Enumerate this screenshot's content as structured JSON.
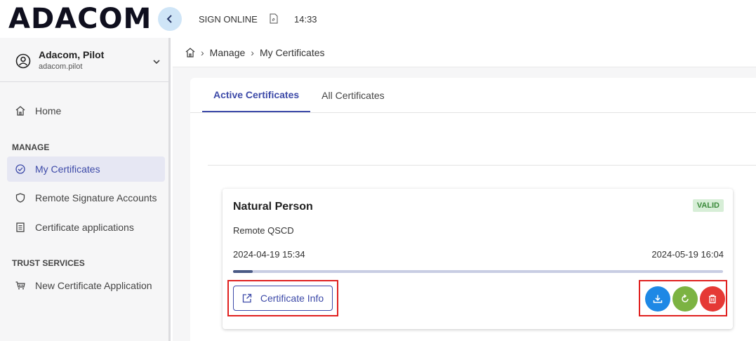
{
  "header": {
    "logo": "ADACOM",
    "app_label": "SIGN ONLINE",
    "time": "14:33",
    "icons": {
      "collapse": "chevron-left-icon",
      "pdf": "pdf-file-icon"
    }
  },
  "user": {
    "name": "Adacom, Pilot",
    "username": "adacom.pilot"
  },
  "sidebar": {
    "home": "Home",
    "manage_label": "MANAGE",
    "manage_items": [
      {
        "label": "My Certificates",
        "icon": "check-circle-icon",
        "active": true
      },
      {
        "label": "Remote Signature Accounts",
        "icon": "shield-icon",
        "active": false
      },
      {
        "label": "Certificate applications",
        "icon": "document-icon",
        "active": false
      }
    ],
    "trust_label": "TRUST SERVICES",
    "trust_items": [
      {
        "label": "New Certificate Application",
        "icon": "cart-icon",
        "active": false
      }
    ]
  },
  "breadcrumb": {
    "items": [
      "Manage",
      "My Certificates"
    ]
  },
  "tabs": [
    {
      "label": "Active Certificates",
      "active": true
    },
    {
      "label": "All Certificates",
      "active": false
    }
  ],
  "certificate": {
    "title": "Natural Person",
    "status": "VALID",
    "type": "Remote QSCD",
    "valid_from": "2024-04-19 15:34",
    "valid_to": "2024-05-19 16:04",
    "progress": 0.04,
    "info_button": "Certificate Info"
  },
  "colors": {
    "accent": "#3d4aa8",
    "valid_badge_bg": "#d7eed7",
    "download": "#1e88e5",
    "renew": "#7cb342",
    "delete": "#e53935",
    "highlight": "#e0201f"
  }
}
